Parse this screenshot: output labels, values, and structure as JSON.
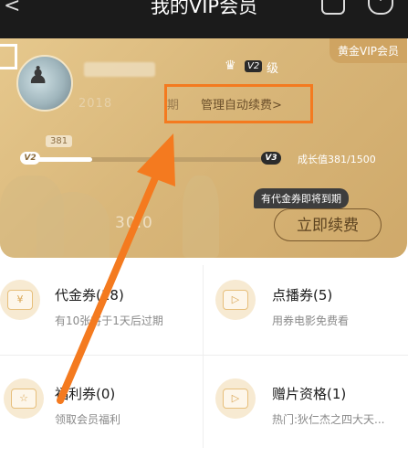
{
  "topbar": {
    "title": "我的VIP会员",
    "back": "<"
  },
  "card": {
    "badge": "黄金VIP会员",
    "level_badge": "V2",
    "level_text": "级",
    "date": "2018",
    "expire": "期",
    "manage": "管理自动续费>",
    "popover_value": "381",
    "start_level": "V2",
    "end_level": "V3",
    "growth": "成长值381/1500",
    "growth_progress": 0.254,
    "coupon_tip": "有代金券即将到期",
    "renew": "立即续费",
    "price": "30.0"
  },
  "grid": [
    {
      "title": "代金券(18)",
      "sub": "有10张将于1天后过期",
      "icon": "coupon-icon",
      "glyph": "¥"
    },
    {
      "title": "点播券(5)",
      "sub": "用券电影免费看",
      "icon": "play-ticket-icon",
      "glyph": "▷"
    },
    {
      "title": "福利券(0)",
      "sub": "领取会员福利",
      "icon": "star-ticket-icon",
      "glyph": "☆"
    },
    {
      "title": "赠片资格(1)",
      "sub": "热门:狄仁杰之四大天...",
      "icon": "tv-icon",
      "glyph": "▷"
    }
  ],
  "colors": {
    "accent": "#f47a1f",
    "gold": "#d9b77a"
  }
}
